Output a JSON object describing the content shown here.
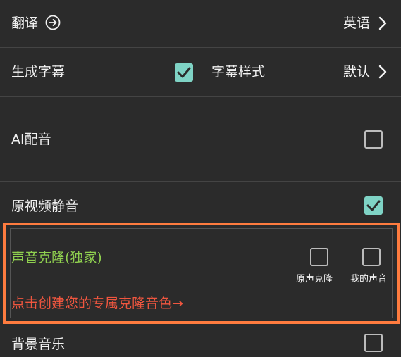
{
  "colors": {
    "background": "#2b2b2b",
    "accent": "#7fd3c5",
    "highlight": "#ff7c3f",
    "clone_title": "#8fd04f",
    "clone_link": "#f0563f"
  },
  "translate": {
    "label": "翻译",
    "info_icon": "circle-arrow-right-icon",
    "value": "英语"
  },
  "subtitles": {
    "label": "生成字幕",
    "checked": true,
    "style_label": "字幕样式",
    "style_value": "默认"
  },
  "ai_dub": {
    "label": "AI配音",
    "checked": false
  },
  "mute_original": {
    "label": "原视频静音",
    "checked": true
  },
  "voice_clone": {
    "title": "声音克隆(独家)",
    "option_original": "原声克隆",
    "option_original_checked": false,
    "option_mine": "我的声音",
    "option_mine_checked": false,
    "link_text": "点击创建您的专属克隆音色→"
  },
  "bgm": {
    "label": "背景音乐",
    "checked": false
  }
}
